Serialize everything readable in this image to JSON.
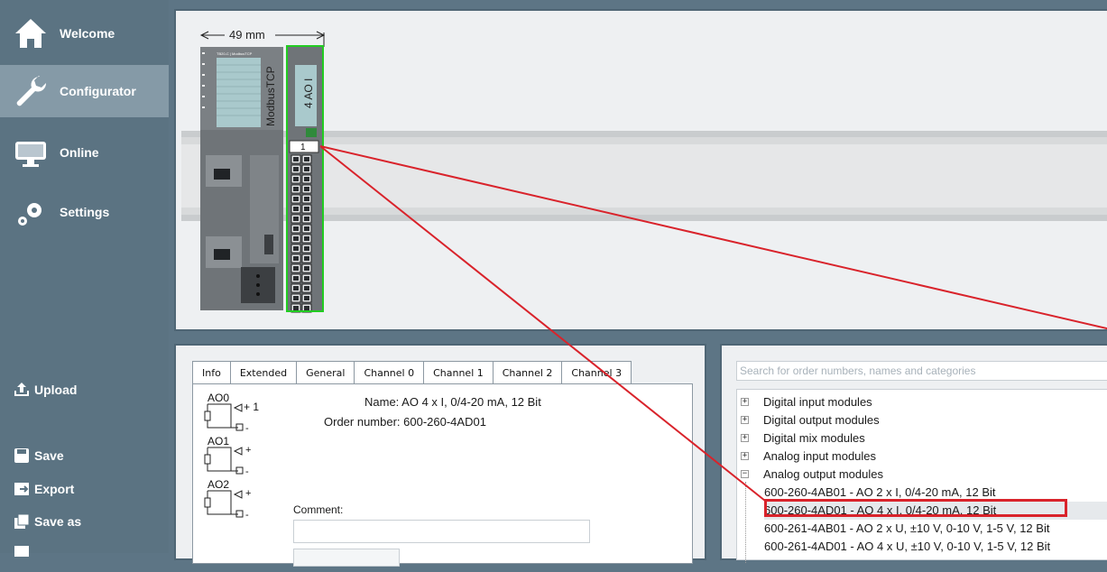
{
  "sidebar": {
    "nav": [
      {
        "label": "Welcome"
      },
      {
        "label": "Configurator"
      },
      {
        "label": "Online"
      },
      {
        "label": "Settings"
      }
    ],
    "actions": [
      {
        "label": "Upload"
      },
      {
        "label": "Save"
      },
      {
        "label": "Export"
      },
      {
        "label": "Save as"
      }
    ]
  },
  "canvas": {
    "dimension_label": "49 mm",
    "controller_label": "ModbusTCP",
    "controller_small_label": "TB20-C | ModbusTCP",
    "module_label": "4 AO I",
    "slot_number": "1"
  },
  "props": {
    "tabs": [
      "Info",
      "Extended",
      "General",
      "Channel 0",
      "Channel 1",
      "Channel 2",
      "Channel 3"
    ],
    "active_tab": "Info",
    "channels": [
      "AO0",
      "AO1",
      "AO2"
    ],
    "ch0_plus": "+ 1",
    "name_line": "Name: AO 4 x I, 0/4-20 mA, 12 Bit",
    "order_line": "Order number: 600-260-4AD01",
    "comment_label": "Comment:"
  },
  "catalog": {
    "search_placeholder": "Search for order numbers, names and categories",
    "categories": [
      "Digital input modules",
      "Digital output modules",
      "Digital mix modules",
      "Analog input modules",
      "Analog output modules"
    ],
    "items": [
      "600-260-4AB01 - AO 2 x I, 0/4-20 mA, 12 Bit",
      "600-260-4AD01 - AO 4 x I, 0/4-20 mA, 12 Bit",
      "600-261-4AB01 - AO 2 x U, ±10 V, 0-10 V, 1-5 V, 12 Bit",
      "600-261-4AD01 - AO 4 x U, ±10 V, 0-10 V, 1-5 V, 12 Bit"
    ]
  },
  "colors": {
    "sidebar": "#5b7382",
    "sidebar_active": "#859aa7",
    "highlight": "#d9232b",
    "module_outline": "#22cc22"
  }
}
